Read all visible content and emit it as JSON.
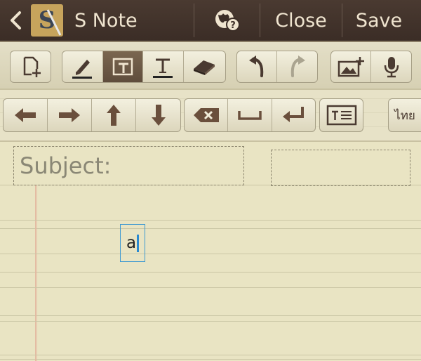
{
  "title_bar": {
    "app_title": "S Note",
    "logo_letter": "S",
    "close_label": "Close",
    "save_label": "Save"
  },
  "toolbar": {
    "tools": [
      "page-layout-icon",
      "pen-icon",
      "text-frame-icon",
      "text-icon",
      "eraser-icon",
      "undo-icon",
      "redo-icon",
      "insert-image-icon",
      "microphone-icon"
    ],
    "active_tool": "text-frame-icon"
  },
  "keyboard_bar": {
    "keys": [
      "arrow-left-icon",
      "arrow-right-icon",
      "arrow-up-icon",
      "arrow-down-icon",
      "backspace-icon",
      "space-icon",
      "enter-icon",
      "keyboard-icon"
    ],
    "language_label": "ไทย"
  },
  "note": {
    "subject_label": "Subject:",
    "text_value": "a"
  },
  "colors": {
    "title_bar": "#3b2d26",
    "paper": "#e9e4c3",
    "icon": "#5f4a3a",
    "cursor": "#2a8ad0"
  }
}
